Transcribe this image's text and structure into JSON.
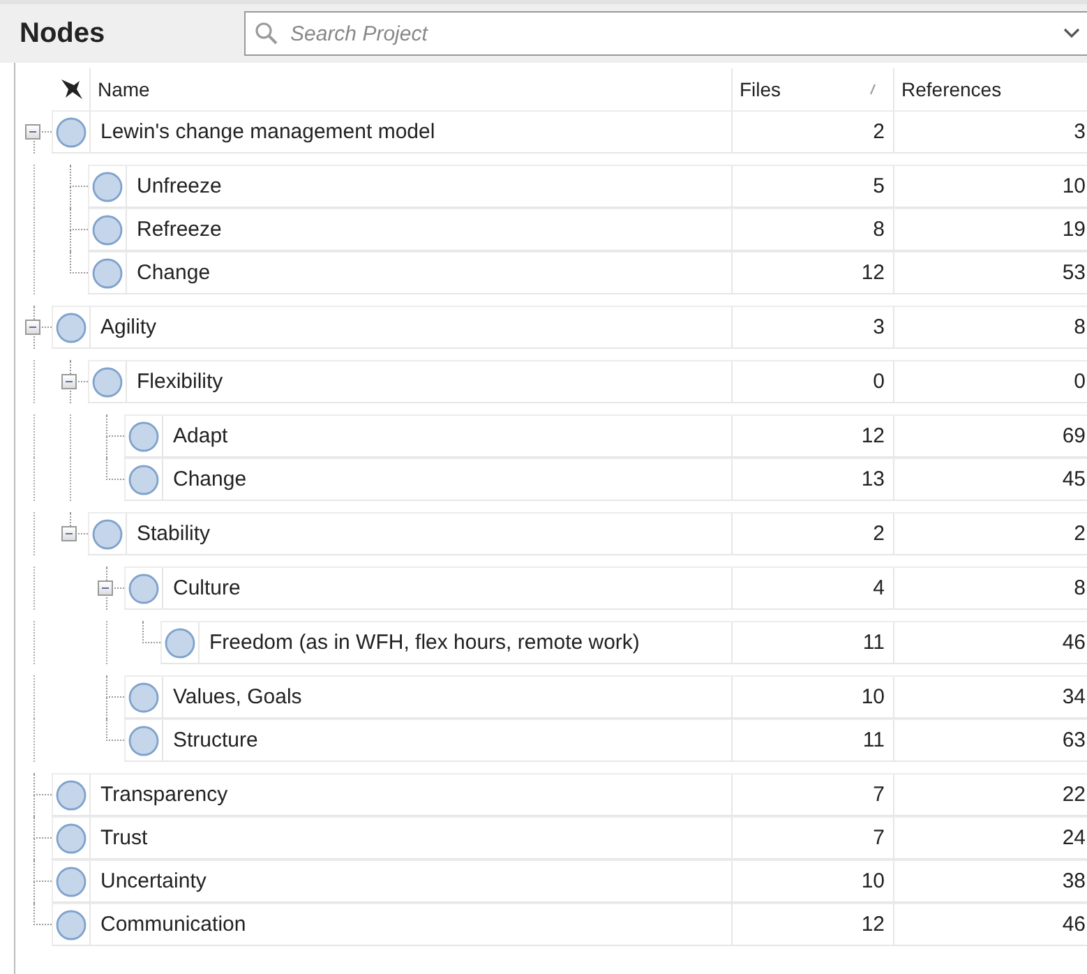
{
  "panel": {
    "title": "Nodes"
  },
  "search": {
    "placeholder": "Search Project"
  },
  "columns": [
    {
      "label": "Name",
      "sorted": false
    },
    {
      "label": "Files",
      "sorted": true
    },
    {
      "label": "References",
      "sorted": false
    }
  ],
  "nodes": [
    {
      "name": "Lewin's change management model",
      "files": "2",
      "references": "3",
      "expanded": true,
      "children": [
        {
          "name": "Unfreeze",
          "files": "5",
          "references": "10"
        },
        {
          "name": "Refreeze",
          "files": "8",
          "references": "19"
        },
        {
          "name": "Change",
          "files": "12",
          "references": "53"
        }
      ]
    },
    {
      "name": "Agility",
      "files": "3",
      "references": "8",
      "expanded": true,
      "children": [
        {
          "name": "Flexibility",
          "files": "0",
          "references": "0",
          "expanded": true,
          "children": [
            {
              "name": "Adapt",
              "files": "12",
              "references": "69"
            },
            {
              "name": "Change",
              "files": "13",
              "references": "45"
            }
          ]
        },
        {
          "name": "Stability",
          "files": "2",
          "references": "2",
          "expanded": true,
          "children": [
            {
              "name": "Culture",
              "files": "4",
              "references": "8",
              "expanded": true,
              "children": [
                {
                  "name": "Freedom (as in WFH, flex hours, remote work)",
                  "files": "11",
                  "references": "46"
                }
              ]
            },
            {
              "name": "Values, Goals",
              "files": "10",
              "references": "34"
            },
            {
              "name": "Structure",
              "files": "11",
              "references": "63"
            }
          ]
        }
      ]
    },
    {
      "name": "Transparency",
      "files": "7",
      "references": "22"
    },
    {
      "name": "Trust",
      "files": "7",
      "references": "24"
    },
    {
      "name": "Uncertainty",
      "files": "10",
      "references": "38"
    },
    {
      "name": "Communication",
      "files": "12",
      "references": "46"
    }
  ]
}
